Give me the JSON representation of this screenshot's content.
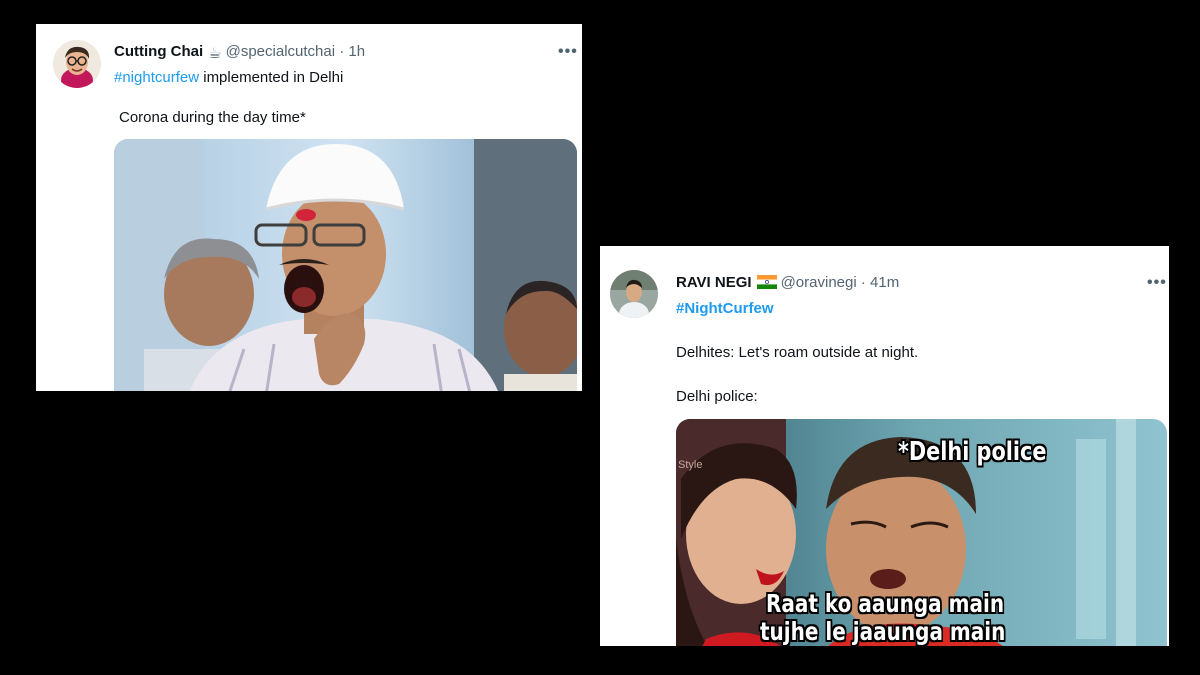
{
  "tweets": [
    {
      "display_name": "Cutting Chai",
      "emoji": "☕",
      "handle": "@specialcutchai",
      "separator": "·",
      "time": "1h",
      "more_icon": "more-horizontal-icon",
      "hashtag": "#nightcurfew",
      "line1_rest": " implemented in Delhi",
      "line2": "Corona during the day time*",
      "media_description_icon": "photo-man-yawning"
    },
    {
      "display_name": "RAVI NEGI",
      "emoji": "🇮🇳",
      "handle": "@oravinegi",
      "separator": "·",
      "time": "41m",
      "more_icon": "more-horizontal-icon",
      "hashtag": "#NightCurfew",
      "line2": "Delhites: Let's roam outside at night.",
      "line3": "Delhi police:",
      "meme_top": "*Delhi police",
      "meme_bottom_1": "Raat ko aaunga main",
      "meme_bottom_2": "tujhe le jaaunga main",
      "watermark": "Style"
    }
  ],
  "colors": {
    "link": "#1d9bf0",
    "text": "#0f1419",
    "secondary": "#536471",
    "background": "#000000"
  }
}
